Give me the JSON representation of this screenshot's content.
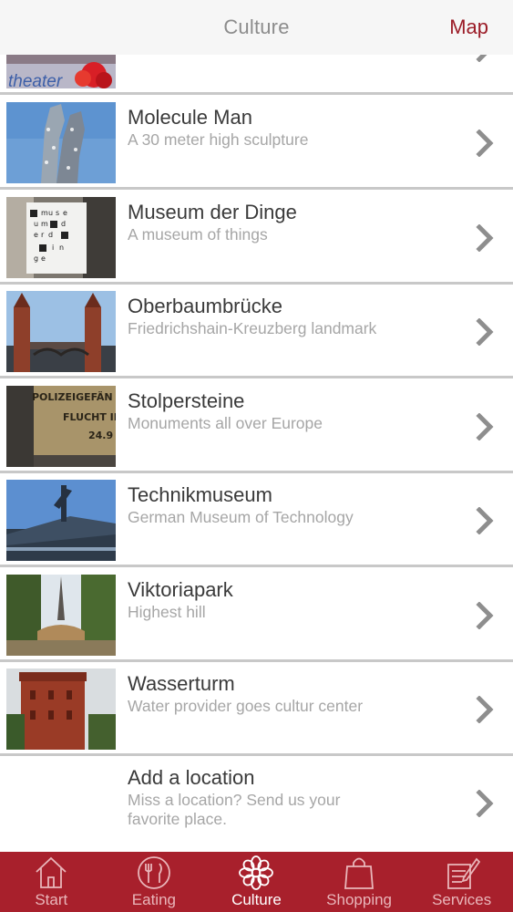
{
  "nav": {
    "title": "Culture",
    "right_button": "Map"
  },
  "items": [
    {
      "title": "",
      "subtitle": "",
      "image": "theater-image"
    },
    {
      "title": "Molecule Man",
      "subtitle": "A 30 meter high sculpture",
      "image": "molecule-man-image"
    },
    {
      "title": "Museum der Dinge",
      "subtitle": "A museum of things",
      "image": "museum-der-dinge-image"
    },
    {
      "title": "Oberbaumbrücke",
      "subtitle": "Friedrichshain-Kreuzberg landmark",
      "image": "oberbaumbruecke-image"
    },
    {
      "title": "Stolpersteine",
      "subtitle": "Monuments all over Europe",
      "image": "stolpersteine-image"
    },
    {
      "title": "Technikmuseum",
      "subtitle": "German Museum of Technology",
      "image": "technikmuseum-image"
    },
    {
      "title": "Viktoriapark",
      "subtitle": "Highest hill",
      "image": "viktoriapark-image"
    },
    {
      "title": "Wasserturm",
      "subtitle": "Water provider goes cultur center",
      "image": "wasserturm-image"
    },
    {
      "title": "Add a location",
      "subtitle": "Miss a location? Send us your favorite place.",
      "image": ""
    }
  ],
  "thumb_text": {
    "theater": "theater",
    "museum_sign": [
      "m",
      "u",
      "s",
      "e",
      "u",
      "m",
      "d",
      "e",
      "r",
      "d",
      "i",
      "n",
      "g",
      "e"
    ],
    "stolpersteine_line1": "POLIZEIGEFÄN",
    "stolpersteine_line2": "FLUCHT IN",
    "stolpersteine_line3": "24.9"
  },
  "tabs": [
    {
      "label": "Start",
      "icon": "house-icon",
      "active": false
    },
    {
      "label": "Eating",
      "icon": "plate-fork-knife-icon",
      "active": false
    },
    {
      "label": "Culture",
      "icon": "flower-icon",
      "active": true
    },
    {
      "label": "Shopping",
      "icon": "shopping-bag-icon",
      "active": false
    },
    {
      "label": "Services",
      "icon": "notepad-pencil-icon",
      "active": false
    }
  ],
  "colors": {
    "accent": "#a8202c",
    "map_text": "#9b1c27",
    "title_gray": "#8c8c8c"
  }
}
